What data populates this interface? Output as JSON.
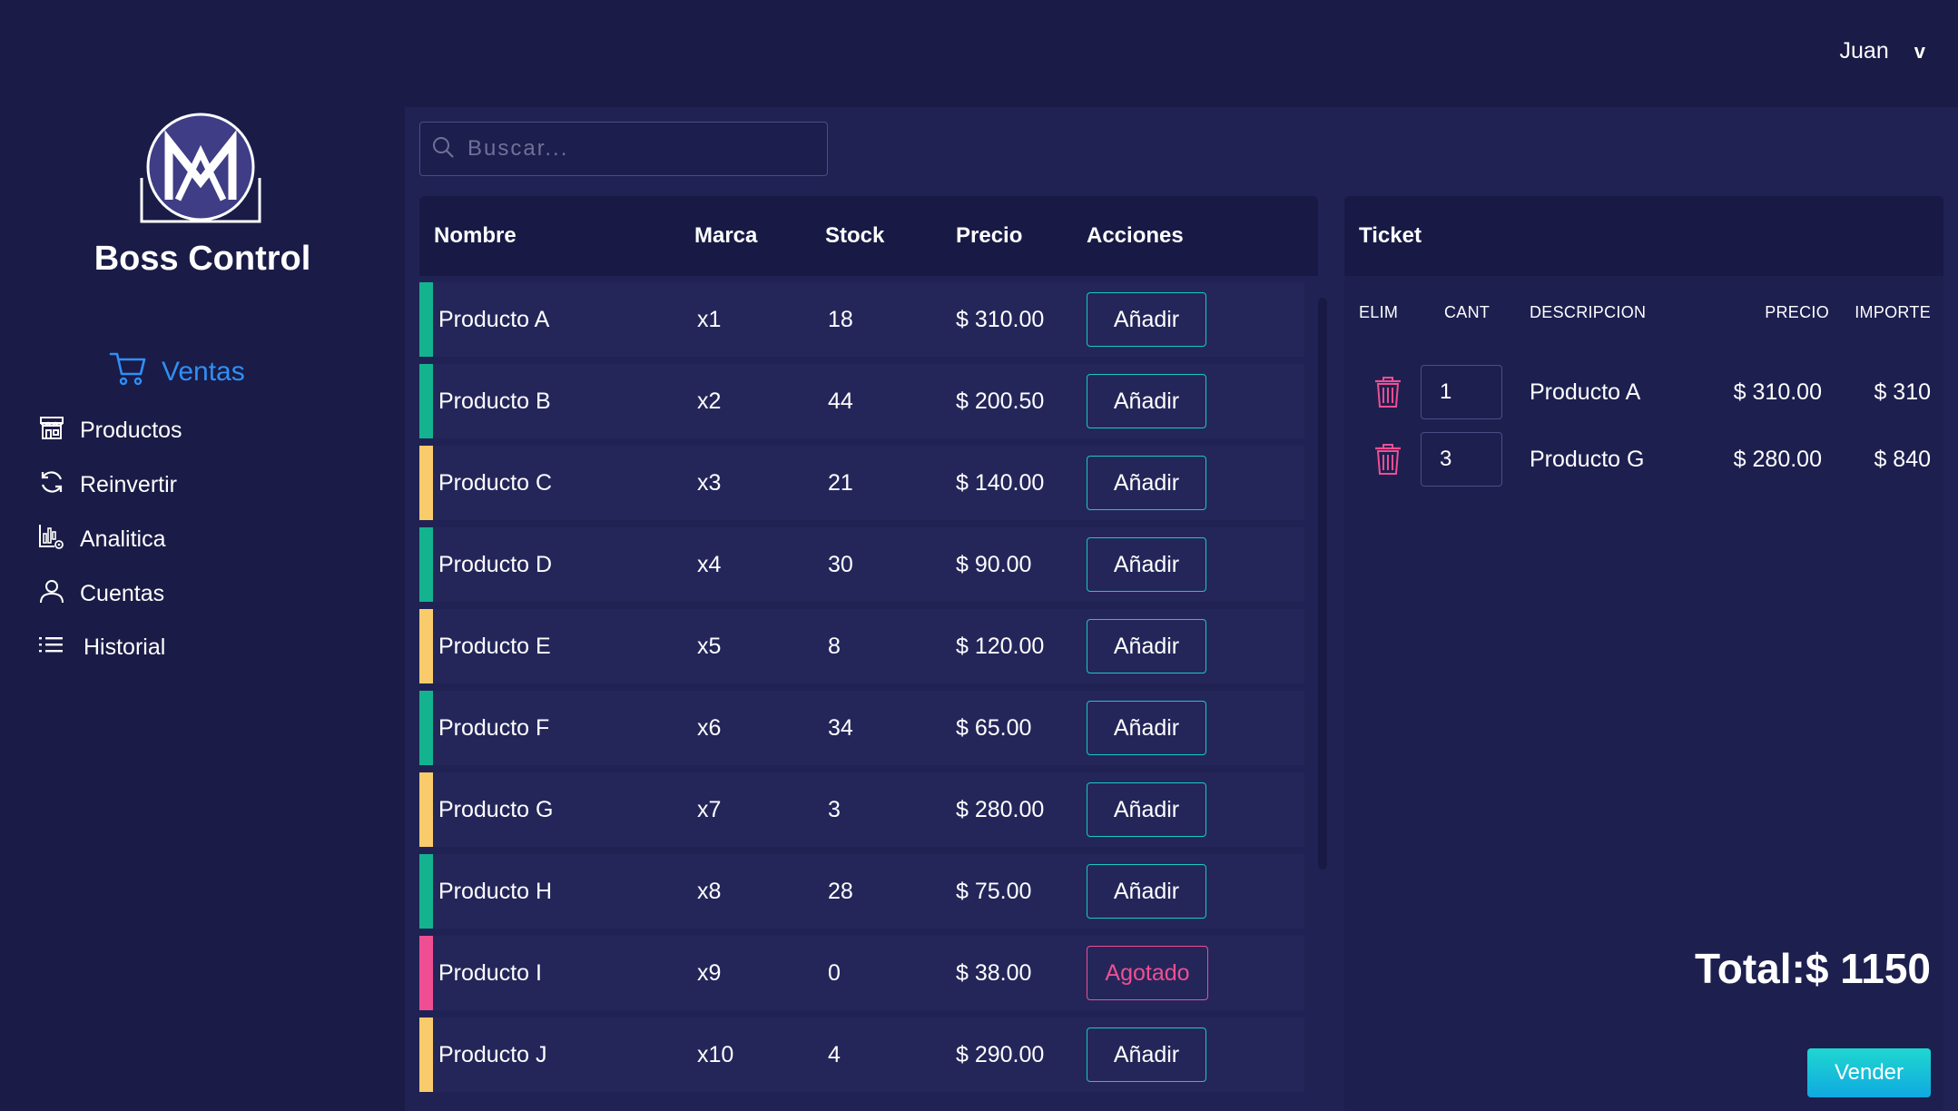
{
  "user": {
    "name": "Juan",
    "menu_chevron": "v"
  },
  "brand": {
    "name": "Boss Control",
    "logo_icon": "boss-control-logo"
  },
  "nav": {
    "active": {
      "label": "Ventas",
      "icon": "cart-icon"
    },
    "items": [
      {
        "label": "Productos",
        "icon": "store-icon"
      },
      {
        "label": "Reinvertir",
        "icon": "refresh-icon"
      },
      {
        "label": "Analitica",
        "icon": "analytics-icon"
      },
      {
        "label": "Cuentas",
        "icon": "user-icon"
      },
      {
        "label": "Historial",
        "icon": "list-icon"
      }
    ]
  },
  "search": {
    "placeholder": "Buscar...",
    "value": ""
  },
  "products": {
    "columns": [
      "Nombre",
      "Marca",
      "Stock",
      "Precio",
      "Acciones"
    ],
    "rows": [
      {
        "name": "Producto A",
        "brand": "x1",
        "stock": "18",
        "price": "$ 310.00",
        "action": "Añadir",
        "status_color": "#14b38f"
      },
      {
        "name": "Producto B",
        "brand": "x2",
        "stock": "44",
        "price": "$ 200.50",
        "action": "Añadir",
        "status_color": "#14b38f"
      },
      {
        "name": "Producto C",
        "brand": "x3",
        "stock": "21",
        "price": "$ 140.00",
        "action": "Añadir",
        "status_color": "#f9cb6a"
      },
      {
        "name": "Producto D",
        "brand": "x4",
        "stock": "30",
        "price": "$ 90.00",
        "action": "Añadir",
        "status_color": "#14b38f"
      },
      {
        "name": "Producto E",
        "brand": "x5",
        "stock": "8",
        "price": "$ 120.00",
        "action": "Añadir",
        "status_color": "#f9cb6a"
      },
      {
        "name": "Producto F",
        "brand": "x6",
        "stock": "34",
        "price": "$ 65.00",
        "action": "Añadir",
        "status_color": "#14b38f"
      },
      {
        "name": "Producto G",
        "brand": "x7",
        "stock": "3",
        "price": "$ 280.00",
        "action": "Añadir",
        "status_color": "#f9cb6a"
      },
      {
        "name": "Producto H",
        "brand": "x8",
        "stock": "28",
        "price": "$ 75.00",
        "action": "Añadir",
        "status_color": "#14b38f"
      },
      {
        "name": "Producto I",
        "brand": "x9",
        "stock": "0",
        "price": "$ 38.00",
        "action": "Agotado",
        "status_color": "#ef4f92"
      },
      {
        "name": "Producto J",
        "brand": "x10",
        "stock": "4",
        "price": "$ 290.00",
        "action": "Añadir",
        "status_color": "#f9cb6a"
      }
    ]
  },
  "ticket": {
    "title": "Ticket",
    "columns": [
      "ELIM",
      "CANT",
      "DESCRIPCION",
      "PRECIO",
      "IMPORTE"
    ],
    "items": [
      {
        "qty": "1",
        "description": "Producto A",
        "price": "$ 310.00",
        "amount": "$ 310",
        "delete_icon": "trash-icon"
      },
      {
        "qty": "3",
        "description": "Producto G",
        "price": "$ 280.00",
        "amount": "$ 840",
        "delete_icon": "trash-icon"
      }
    ],
    "total_label": "Total:$ 1150",
    "sell_label": "Vender"
  },
  "colors": {
    "background": "#1a1b46",
    "panel": "#202254",
    "accent_teal": "#18c8c4",
    "accent_blue": "#2f8ff7",
    "status_green": "#14b38f",
    "status_yellow": "#f9cb6a",
    "status_pink": "#ef4f92"
  }
}
